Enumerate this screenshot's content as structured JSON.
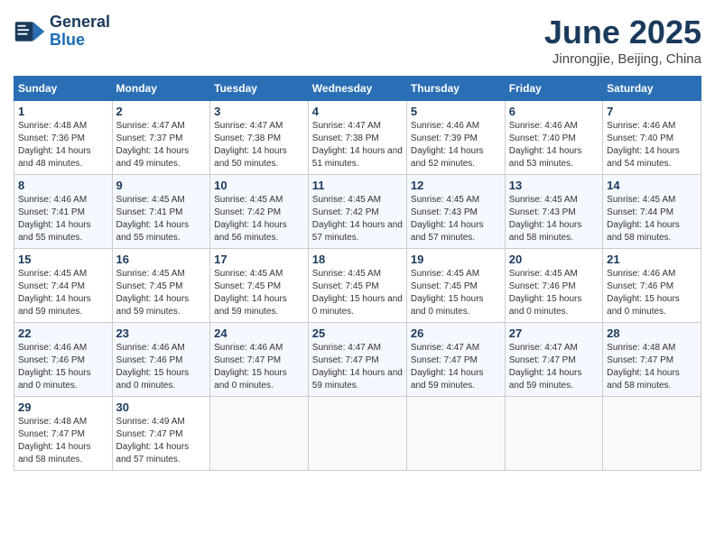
{
  "header": {
    "logo_line1": "General",
    "logo_line2": "Blue",
    "month": "June 2025",
    "location": "Jinrongjie, Beijing, China"
  },
  "weekdays": [
    "Sunday",
    "Monday",
    "Tuesday",
    "Wednesday",
    "Thursday",
    "Friday",
    "Saturday"
  ],
  "weeks": [
    [
      {
        "day": "1",
        "info": "Sunrise: 4:48 AM\nSunset: 7:36 PM\nDaylight: 14 hours and 48 minutes."
      },
      {
        "day": "2",
        "info": "Sunrise: 4:47 AM\nSunset: 7:37 PM\nDaylight: 14 hours and 49 minutes."
      },
      {
        "day": "3",
        "info": "Sunrise: 4:47 AM\nSunset: 7:38 PM\nDaylight: 14 hours and 50 minutes."
      },
      {
        "day": "4",
        "info": "Sunrise: 4:47 AM\nSunset: 7:38 PM\nDaylight: 14 hours and 51 minutes."
      },
      {
        "day": "5",
        "info": "Sunrise: 4:46 AM\nSunset: 7:39 PM\nDaylight: 14 hours and 52 minutes."
      },
      {
        "day": "6",
        "info": "Sunrise: 4:46 AM\nSunset: 7:40 PM\nDaylight: 14 hours and 53 minutes."
      },
      {
        "day": "7",
        "info": "Sunrise: 4:46 AM\nSunset: 7:40 PM\nDaylight: 14 hours and 54 minutes."
      }
    ],
    [
      {
        "day": "8",
        "info": "Sunrise: 4:46 AM\nSunset: 7:41 PM\nDaylight: 14 hours and 55 minutes."
      },
      {
        "day": "9",
        "info": "Sunrise: 4:45 AM\nSunset: 7:41 PM\nDaylight: 14 hours and 55 minutes."
      },
      {
        "day": "10",
        "info": "Sunrise: 4:45 AM\nSunset: 7:42 PM\nDaylight: 14 hours and 56 minutes."
      },
      {
        "day": "11",
        "info": "Sunrise: 4:45 AM\nSunset: 7:42 PM\nDaylight: 14 hours and 57 minutes."
      },
      {
        "day": "12",
        "info": "Sunrise: 4:45 AM\nSunset: 7:43 PM\nDaylight: 14 hours and 57 minutes."
      },
      {
        "day": "13",
        "info": "Sunrise: 4:45 AM\nSunset: 7:43 PM\nDaylight: 14 hours and 58 minutes."
      },
      {
        "day": "14",
        "info": "Sunrise: 4:45 AM\nSunset: 7:44 PM\nDaylight: 14 hours and 58 minutes."
      }
    ],
    [
      {
        "day": "15",
        "info": "Sunrise: 4:45 AM\nSunset: 7:44 PM\nDaylight: 14 hours and 59 minutes."
      },
      {
        "day": "16",
        "info": "Sunrise: 4:45 AM\nSunset: 7:45 PM\nDaylight: 14 hours and 59 minutes."
      },
      {
        "day": "17",
        "info": "Sunrise: 4:45 AM\nSunset: 7:45 PM\nDaylight: 14 hours and 59 minutes."
      },
      {
        "day": "18",
        "info": "Sunrise: 4:45 AM\nSunset: 7:45 PM\nDaylight: 15 hours and 0 minutes."
      },
      {
        "day": "19",
        "info": "Sunrise: 4:45 AM\nSunset: 7:45 PM\nDaylight: 15 hours and 0 minutes."
      },
      {
        "day": "20",
        "info": "Sunrise: 4:45 AM\nSunset: 7:46 PM\nDaylight: 15 hours and 0 minutes."
      },
      {
        "day": "21",
        "info": "Sunrise: 4:46 AM\nSunset: 7:46 PM\nDaylight: 15 hours and 0 minutes."
      }
    ],
    [
      {
        "day": "22",
        "info": "Sunrise: 4:46 AM\nSunset: 7:46 PM\nDaylight: 15 hours and 0 minutes."
      },
      {
        "day": "23",
        "info": "Sunrise: 4:46 AM\nSunset: 7:46 PM\nDaylight: 15 hours and 0 minutes."
      },
      {
        "day": "24",
        "info": "Sunrise: 4:46 AM\nSunset: 7:47 PM\nDaylight: 15 hours and 0 minutes."
      },
      {
        "day": "25",
        "info": "Sunrise: 4:47 AM\nSunset: 7:47 PM\nDaylight: 14 hours and 59 minutes."
      },
      {
        "day": "26",
        "info": "Sunrise: 4:47 AM\nSunset: 7:47 PM\nDaylight: 14 hours and 59 minutes."
      },
      {
        "day": "27",
        "info": "Sunrise: 4:47 AM\nSunset: 7:47 PM\nDaylight: 14 hours and 59 minutes."
      },
      {
        "day": "28",
        "info": "Sunrise: 4:48 AM\nSunset: 7:47 PM\nDaylight: 14 hours and 58 minutes."
      }
    ],
    [
      {
        "day": "29",
        "info": "Sunrise: 4:48 AM\nSunset: 7:47 PM\nDaylight: 14 hours and 58 minutes."
      },
      {
        "day": "30",
        "info": "Sunrise: 4:49 AM\nSunset: 7:47 PM\nDaylight: 14 hours and 57 minutes."
      },
      {
        "day": "",
        "info": ""
      },
      {
        "day": "",
        "info": ""
      },
      {
        "day": "",
        "info": ""
      },
      {
        "day": "",
        "info": ""
      },
      {
        "day": "",
        "info": ""
      }
    ]
  ]
}
